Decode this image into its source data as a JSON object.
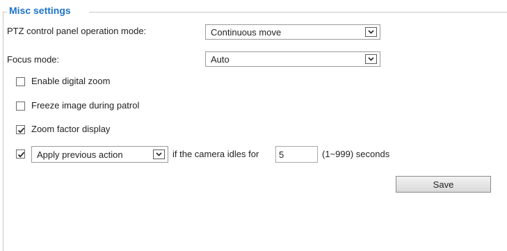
{
  "section": {
    "title": "Misc settings"
  },
  "ptz_mode": {
    "label": "PTZ control panel operation mode:",
    "value": "Continuous move"
  },
  "focus_mode": {
    "label": "Focus mode:",
    "value": "Auto"
  },
  "digital_zoom": {
    "label": "Enable digital zoom",
    "checked": false
  },
  "freeze_image": {
    "label": "Freeze image during patrol",
    "checked": false
  },
  "zoom_display": {
    "label": "Zoom factor display",
    "checked": true
  },
  "idle_action": {
    "checked": true,
    "action_value": "Apply previous action",
    "prefix": "if the camera idles for",
    "seconds": "5",
    "suffix": "(1~999) seconds"
  },
  "save_label": "Save"
}
